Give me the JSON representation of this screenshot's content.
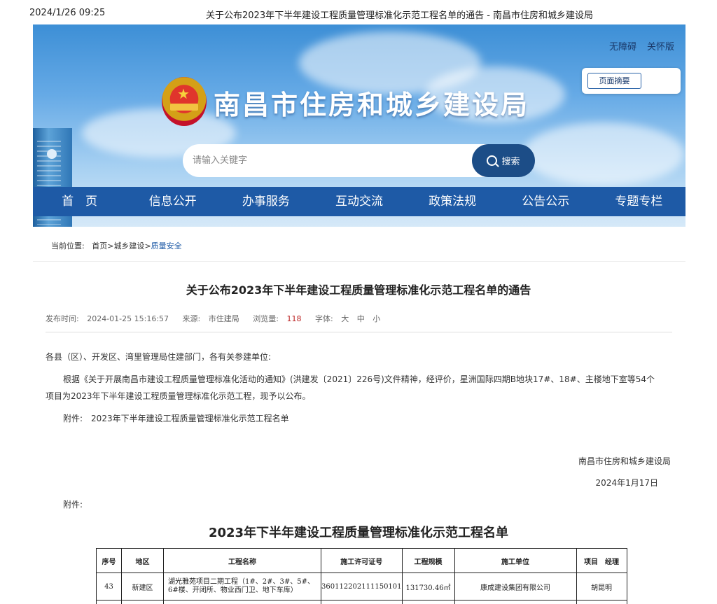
{
  "print_header": {
    "datetime": "2024/1/26 09:25",
    "title": "关于公布2023年下半年建设工程质量管理标准化示范工程名单的通告 - 南昌市住房和城乡建设局"
  },
  "banner": {
    "site_name": "南昌市住房和城乡建设局",
    "accessibility_link": "无障碍",
    "care_link": "关怀版",
    "summary_button": "页面摘要",
    "search_placeholder": "请输入关键字",
    "search_button": "搜索"
  },
  "nav": [
    "首　页",
    "信息公开",
    "办事服务",
    "互动交流",
    "政策法规",
    "公告公示",
    "专题专栏"
  ],
  "breadcrumb": {
    "label": "当前位置:",
    "items": [
      "首页",
      "城乡建设",
      "质量安全"
    ],
    "separator": ">"
  },
  "article": {
    "title": "关于公布2023年下半年建设工程质量管理标准化示范工程名单的通告",
    "meta": {
      "publish_label": "发布时间:",
      "publish_time": "2024-01-25 15:16:57",
      "source_label": "来源:",
      "source": "市住建局",
      "views_label": "浏览量:",
      "views": "118",
      "font_label": "字体:",
      "font_sizes": [
        "大",
        "中",
        "小"
      ]
    },
    "salutation": "各县（区）、开发区、湾里管理局住建部门，各有关参建单位:",
    "body_line1": "根据《关于开展南昌市建设工程质量管理标准化活动的通知》(洪建发〔2021〕226号)文件精神，经评价，星洲国际四期B地块17#、18#、主楼地下室等54个",
    "body_line2": "项目为2023年下半年建设工程质量管理标准化示范工程，现予以公布。",
    "attachment_line": "附件:　2023年下半年建设工程质量管理标准化示范工程名单",
    "sign_org": "南昌市住房和城乡建设局",
    "sign_date": "2024年1月17日",
    "attachment_label": "附件:"
  },
  "table": {
    "title": "2023年下半年建设工程质量管理标准化示范工程名单",
    "headers": [
      "序号",
      "地区",
      "工程名称",
      "施工许可证号",
      "工程规模",
      "施工单位",
      "项目　经理"
    ],
    "rows": [
      [
        "43",
        "新建区",
        "湖光雅苑项目二期工程（1#、2#、3#、5#、6#楼、开闭所、物业西门卫、地下车库）",
        "360112202111150101",
        "131730.46㎡",
        "康成建设集团有限公司",
        "胡昆明"
      ]
    ]
  }
}
